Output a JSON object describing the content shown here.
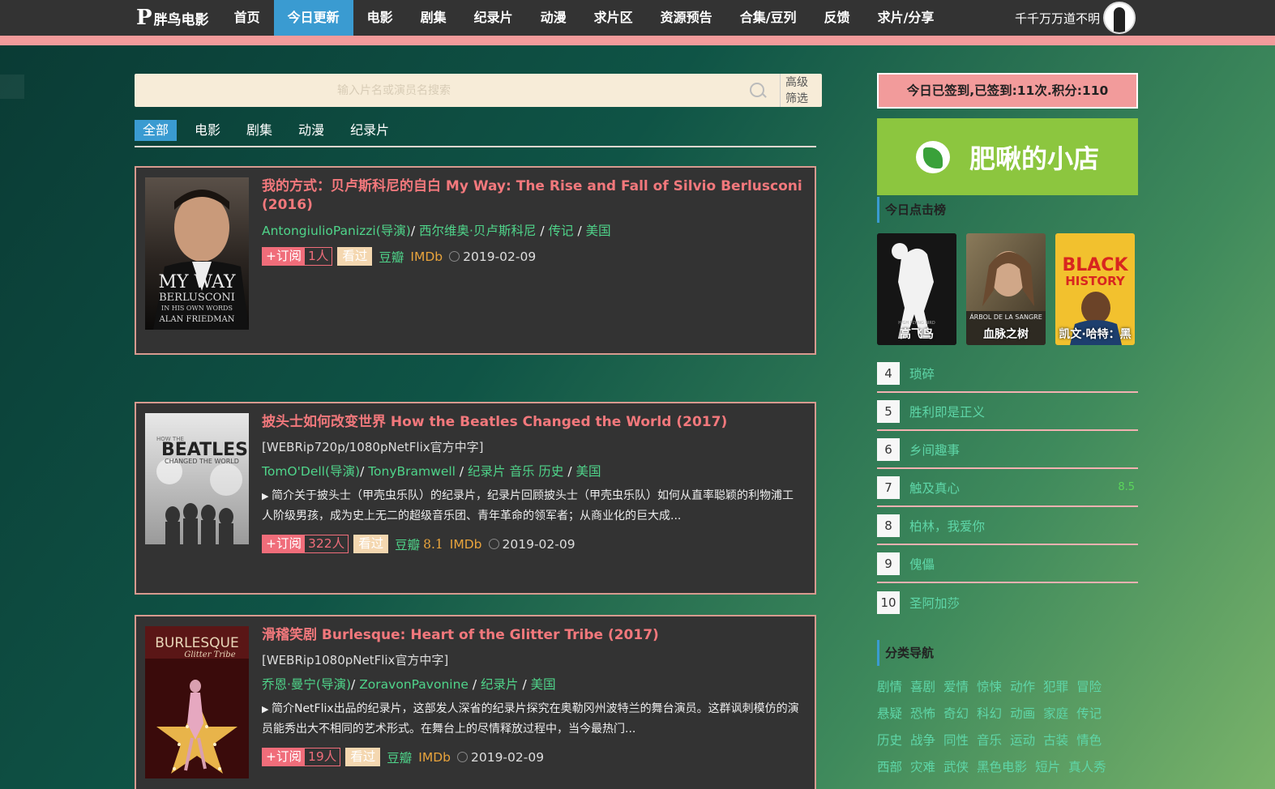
{
  "nav": {
    "logo_mark": "P",
    "logo_text": "胖鸟电影",
    "items": [
      "首页",
      "今日更新",
      "电影",
      "剧集",
      "纪录片",
      "动漫",
      "求片区",
      "资源预告",
      "合集/豆列",
      "反馈",
      "求片/分享"
    ],
    "active_index": 1,
    "username": "千千万万道不明"
  },
  "search": {
    "placeholder": "输入片名或演员名搜索",
    "advanced_line1": "高级",
    "advanced_line2": "筛选"
  },
  "filter_tabs": [
    "全部",
    "电影",
    "剧集",
    "动漫",
    "纪录片"
  ],
  "movies": [
    {
      "title": "我的方式：贝卢斯科尼的自白  My Way: The Rise and Fall of Silvio Berlusconi",
      "year": "(2016)",
      "release": "",
      "director": "AntongiulioPanizzi(导演)",
      "actor": "西尔维奥·贝卢斯科尼",
      "genres": "传记",
      "country": "美国",
      "desc": "",
      "sub_label": "+订阅",
      "sub_count": "1人",
      "seen_label": "看过",
      "douban": "豆瓣",
      "douban_score": "",
      "imdb": "IMDb",
      "date": "2019-02-09",
      "poster_text": [
        "MY WAY",
        "BERLUSCONI",
        "IN HIS OWN WORDS",
        "ALAN FRIEDMAN"
      ]
    },
    {
      "title": "披头士如何改变世界  How the Beatles Changed the World",
      "year": "(2017)",
      "release": "[WEBRip720p/1080pNetFlix官方中字]",
      "director": "TomO'Dell(导演)",
      "actor": "TonyBramwell",
      "genres": "纪录片 音乐 历史",
      "country": "美国",
      "desc": "简介关于披头士（甲壳虫乐队）的纪录片，纪录片回顾披头士（甲壳虫乐队）如何从直率聪颖的利物浦工人阶级男孩，成为史上无二的超级音乐团、青年革命的领军者；从商业化的巨大成...",
      "sub_label": "+订阅",
      "sub_count": "322人",
      "seen_label": "看过",
      "douban": "豆瓣",
      "douban_score": "8.1",
      "imdb": "IMDb",
      "date": "2019-02-09",
      "poster_text": [
        "HOW THE",
        "BEATLES",
        "CHANGED THE WORLD"
      ]
    },
    {
      "title": "滑稽笑剧  Burlesque: Heart of the Glitter Tribe",
      "year": "(2017)",
      "release": "[WEBRip1080pNetFlix官方中字]",
      "director": "乔恩·曼宁(导演)",
      "actor": "ZoravonPavonine",
      "genres": "纪录片",
      "country": "美国",
      "desc": "简介NetFlix出品的纪录片，这部发人深省的纪录片探究在奥勒冈州波特兰的舞台演员。这群讽刺模仿的演员能秀出大不相同的艺术形式。在舞台上的尽情释放过程中，当今最热门...",
      "sub_label": "+订阅",
      "sub_count": "19人",
      "seen_label": "看过",
      "douban": "豆瓣",
      "douban_score": "",
      "imdb": "IMDb",
      "date": "2019-02-09",
      "poster_text": [
        "BURLESQUE",
        "Glitter Tribe"
      ]
    }
  ],
  "sidebar": {
    "signin_text": "今日已签到,已签到:11次.积分:110",
    "shop_text": "肥啾的小店",
    "hot_title": "今日点击榜",
    "hot_posters": [
      {
        "caption": "高飞鸟",
        "color": "#111111",
        "accent": "#ffffff"
      },
      {
        "caption": "血脉之树",
        "color": "#6b5a44",
        "accent": "#c9b48f"
      },
      {
        "caption": "凯文·哈特：黑",
        "color": "#f2c12e",
        "accent": "#d8261f"
      }
    ],
    "poster_labels": [
      "HIGH FLYING BIRD",
      "ÁRBOL DE LA SANGRE",
      "BLACK",
      "HISTORY"
    ],
    "ranks": [
      {
        "num": "4",
        "name": "琐碎",
        "score": ""
      },
      {
        "num": "5",
        "name": "胜利即是正义",
        "score": ""
      },
      {
        "num": "6",
        "name": "乡间趣事",
        "score": ""
      },
      {
        "num": "7",
        "name": "触及真心",
        "score": "8.5"
      },
      {
        "num": "8",
        "name": "柏林，我爱你",
        "score": ""
      },
      {
        "num": "9",
        "name": "傀儡",
        "score": ""
      },
      {
        "num": "10",
        "name": "圣阿加莎",
        "score": ""
      }
    ],
    "category_title": "分类导航",
    "categories": [
      [
        "剧情",
        "喜剧",
        "爱情",
        "惊悚",
        "动作",
        "犯罪",
        "冒险"
      ],
      [
        "悬疑",
        "恐怖",
        "奇幻",
        "科幻",
        "动画",
        "家庭",
        "传记"
      ],
      [
        "历史",
        "战争",
        "同性",
        "音乐",
        "运动",
        "古装",
        "情色"
      ],
      [
        "西部",
        "灾难",
        "武侠",
        "黑色电影",
        "短片",
        "真人秀"
      ]
    ]
  },
  "colors": {
    "nav_bg": "#333333",
    "nav_active": "#3a9bd1",
    "accent_pink": "#f29b9b",
    "title_red": "#f2787c",
    "link_green": "#4fd48a",
    "imdb_orange": "#e9a43c",
    "shop_green": "#8cc63f"
  }
}
